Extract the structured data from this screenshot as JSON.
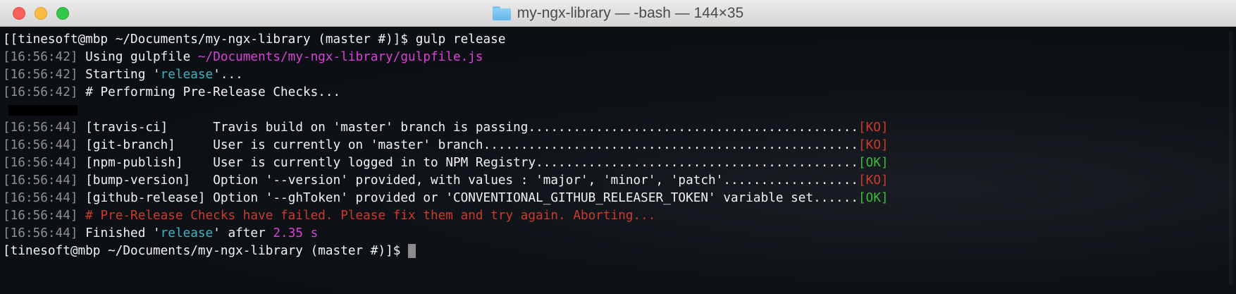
{
  "window": {
    "title": "my-ngx-library — -bash — 144×35",
    "folder_icon": "folder-icon"
  },
  "terminal": {
    "prompt": "[[tinesoft@mbp ~/Documents/my-ngx-library (master #)]$ ",
    "command": "gulp release",
    "lines": [
      {
        "ts": "[16:56:42]",
        "text": " Using gulpfile ",
        "highlight": "~/Documents/my-ngx-library/gulpfile.js"
      },
      {
        "ts": "[16:56:42]",
        "text": " Starting '",
        "highlight": "release",
        "after": "'..."
      },
      {
        "ts": "[16:56:42]",
        "text": " # Performing Pre-Release Checks..."
      }
    ],
    "checks": [
      {
        "ts": "[16:56:44]",
        "tag": "[travis-ci]",
        "message": "Travis build on 'master' branch is passing",
        "status": "[KO]",
        "ok": false
      },
      {
        "ts": "[16:56:44]",
        "tag": "[git-branch]",
        "message": "User is currently on 'master' branch",
        "status": "[KO]",
        "ok": false
      },
      {
        "ts": "[16:56:44]",
        "tag": "[npm-publish]",
        "message": "User is currently logged in to NPM Registry",
        "status": "[OK]",
        "ok": true
      },
      {
        "ts": "[16:56:44]",
        "tag": "[bump-version]",
        "message": "Option '--version' provided, with values : 'major', 'minor', 'patch'",
        "status": "[KO]",
        "ok": false
      },
      {
        "ts": "[16:56:44]",
        "tag": "[github-release]",
        "message": "Option '--ghToken' provided or 'CONVENTIONAL_GITHUB_RELEASER_TOKEN' variable set",
        "status": "[OK]",
        "ok": true
      }
    ],
    "failure": {
      "ts": "[16:56:44]",
      "text": " # Pre-Release Checks have failed. Please fix them and try again. Aborting..."
    },
    "finished": {
      "ts": "[16:56:44]",
      "pre": " Finished '",
      "task": "release",
      "mid": "' after ",
      "duration": "2.35 s"
    },
    "final_prompt": "[tinesoft@mbp ~/Documents/my-ngx-library (master #)]$ "
  },
  "colors": {
    "ok": "#3bbb3b",
    "ko": "#cc3a2c",
    "path": "#d842d6",
    "task": "#37b6c4"
  }
}
